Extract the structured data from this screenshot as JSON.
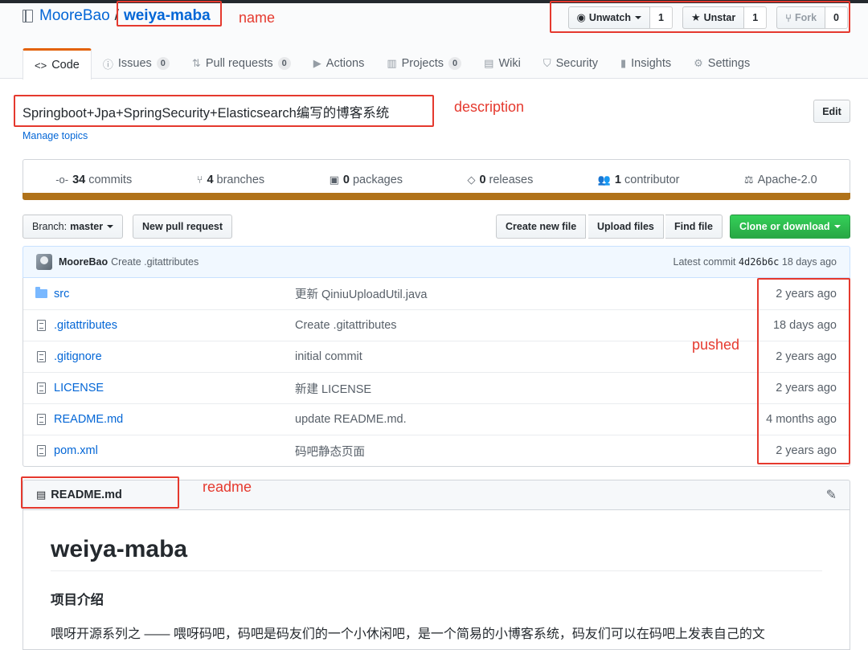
{
  "repo": {
    "owner": "MooreBao",
    "separator": "/",
    "name": "weiya-maba"
  },
  "actions": {
    "watch": {
      "label": "Unwatch",
      "count": "1"
    },
    "star": {
      "label": "Unstar",
      "count": "1"
    },
    "fork": {
      "label": "Fork",
      "count": "0"
    }
  },
  "tabs": [
    {
      "label": "Code",
      "icon": "code-icon"
    },
    {
      "label": "Issues",
      "count": "0",
      "icon": "issue-icon"
    },
    {
      "label": "Pull requests",
      "count": "0",
      "icon": "pull-request-icon"
    },
    {
      "label": "Actions",
      "icon": "play-icon"
    },
    {
      "label": "Projects",
      "count": "0",
      "icon": "project-icon"
    },
    {
      "label": "Wiki",
      "icon": "book-icon"
    },
    {
      "label": "Security",
      "icon": "shield-icon"
    },
    {
      "label": "Insights",
      "icon": "graph-icon"
    },
    {
      "label": "Settings",
      "icon": "gear-icon"
    }
  ],
  "description": "Springboot+Jpa+SpringSecurity+Elasticsearch编写的博客系统",
  "manage_topics": "Manage topics",
  "edit_label": "Edit",
  "summary": {
    "commits": {
      "num": "34",
      "label": "commits"
    },
    "branches": {
      "num": "4",
      "label": "branches"
    },
    "packages": {
      "num": "0",
      "label": "packages"
    },
    "releases": {
      "num": "0",
      "label": "releases"
    },
    "contributors": {
      "num": "1",
      "label": "contributor"
    },
    "license": "Apache-2.0"
  },
  "language_color": "#b07219",
  "filebar": {
    "branch_label": "Branch:",
    "branch": "master",
    "new_pr": "New pull request",
    "create_file": "Create new file",
    "upload_files": "Upload files",
    "find_file": "Find file",
    "clone": "Clone or download"
  },
  "latest_commit": {
    "author": "MooreBao",
    "message": "Create .gitattributes",
    "label": "Latest commit",
    "sha": "4d26b6c",
    "age": "18 days ago"
  },
  "files": [
    {
      "type": "dir",
      "name": "src",
      "message": "更新 QiniuUploadUtil.java",
      "age": "2 years ago"
    },
    {
      "type": "file",
      "name": ".gitattributes",
      "message": "Create .gitattributes",
      "age": "18 days ago"
    },
    {
      "type": "file",
      "name": ".gitignore",
      "message": "initial commit",
      "age": "2 years ago"
    },
    {
      "type": "file",
      "name": "LICENSE",
      "message": "新建 LICENSE",
      "age": "2 years ago"
    },
    {
      "type": "file",
      "name": "README.md",
      "message": "update README.md.",
      "age": "4 months ago"
    },
    {
      "type": "file",
      "name": "pom.xml",
      "message": "码吧静态页面",
      "age": "2 years ago"
    }
  ],
  "readme": {
    "filename": "README.md",
    "title": "weiya-maba",
    "section": "项目介绍",
    "intro": "喂呀开源系列之 —— 喂呀码吧，码吧是码友们的一个小休闲吧，是一个简易的小博客系统，码友们可以在码吧上发表自己的文"
  },
  "annotations": {
    "name": "name",
    "description": "description",
    "pushed": "pushed",
    "readme": "readme",
    "color": "#e5392e"
  }
}
